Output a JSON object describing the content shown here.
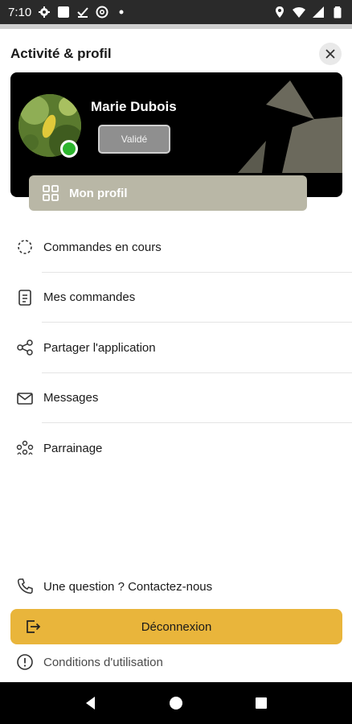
{
  "status_bar": {
    "time": "7:10",
    "left_icons": [
      "settings-icon",
      "square-icon",
      "download-done-icon",
      "at-sign-icon",
      "dot-icon"
    ],
    "right_icons": [
      "location-icon",
      "wifi-icon",
      "signal-icon",
      "battery-icon"
    ]
  },
  "header": {
    "title": "Activité & profil",
    "close_icon": "close-icon"
  },
  "profile": {
    "name": "Marie Dubois",
    "status_button": "Validé",
    "online_color": "#2db52d",
    "my_profile_label": "Mon profil"
  },
  "menu": {
    "items": [
      {
        "label": "Commandes en cours",
        "icon": "loading-circle-icon"
      },
      {
        "label": "Mes commandes",
        "icon": "document-icon"
      },
      {
        "label": "Partager l'application",
        "icon": "share-icon"
      },
      {
        "label": "Messages",
        "icon": "mail-icon"
      },
      {
        "label": "Parrainage",
        "icon": "group-icon"
      }
    ]
  },
  "footer": {
    "contact_label": "Une question ? Contactez-nous",
    "logout_label": "Déconnexion",
    "terms_label": "Conditions d'utilisation"
  },
  "colors": {
    "accent": "#e9b53b",
    "card_bg": "#000000",
    "profile_button_bg": "#b9b7a6"
  }
}
